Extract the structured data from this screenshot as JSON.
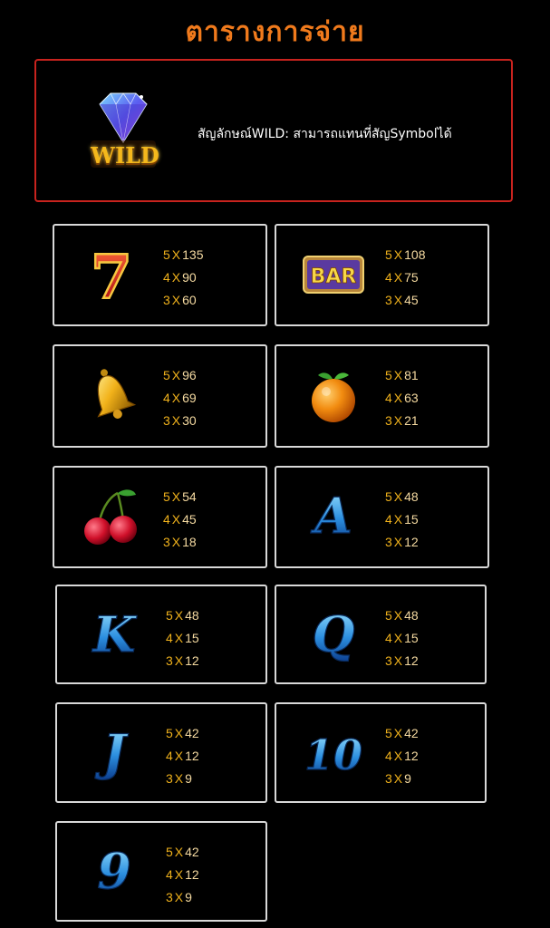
{
  "title": "ตารางการจ่าย",
  "wild": {
    "icon": "diamond-wild-icon",
    "description": "สัญลักษณ์WILD: สามารถแทนที่สัญSymbolได้"
  },
  "colors": {
    "title": "#f07a1c",
    "wild_border": "#c8231e",
    "card_border": "#d9d9d9",
    "multiplier": "#f0b21c"
  },
  "symbols": [
    {
      "icon": "seven-icon",
      "pays": [
        {
          "count": "5",
          "mult": "135"
        },
        {
          "count": "4",
          "mult": "90"
        },
        {
          "count": "3",
          "mult": "60"
        }
      ]
    },
    {
      "icon": "bar-icon",
      "label": "BAR",
      "pays": [
        {
          "count": "5",
          "mult": "108"
        },
        {
          "count": "4",
          "mult": "75"
        },
        {
          "count": "3",
          "mult": "45"
        }
      ]
    },
    {
      "icon": "bell-icon",
      "pays": [
        {
          "count": "5",
          "mult": "96"
        },
        {
          "count": "4",
          "mult": "69"
        },
        {
          "count": "3",
          "mult": "30"
        }
      ]
    },
    {
      "icon": "orange-icon",
      "pays": [
        {
          "count": "5",
          "mult": "81"
        },
        {
          "count": "4",
          "mult": "63"
        },
        {
          "count": "3",
          "mult": "21"
        }
      ]
    },
    {
      "icon": "cherry-icon",
      "pays": [
        {
          "count": "5",
          "mult": "54"
        },
        {
          "count": "4",
          "mult": "45"
        },
        {
          "count": "3",
          "mult": "18"
        }
      ]
    },
    {
      "icon": "letter-a-icon",
      "label": "A",
      "pays": [
        {
          "count": "5",
          "mult": "48"
        },
        {
          "count": "4",
          "mult": "15"
        },
        {
          "count": "3",
          "mult": "12"
        }
      ]
    },
    {
      "icon": "letter-k-icon",
      "label": "K",
      "pays": [
        {
          "count": "5",
          "mult": "48"
        },
        {
          "count": "4",
          "mult": "15"
        },
        {
          "count": "3",
          "mult": "12"
        }
      ]
    },
    {
      "icon": "letter-q-icon",
      "label": "Q",
      "pays": [
        {
          "count": "5",
          "mult": "48"
        },
        {
          "count": "4",
          "mult": "15"
        },
        {
          "count": "3",
          "mult": "12"
        }
      ]
    },
    {
      "icon": "letter-j-icon",
      "label": "J",
      "pays": [
        {
          "count": "5",
          "mult": "42"
        },
        {
          "count": "4",
          "mult": "12"
        },
        {
          "count": "3",
          "mult": "9"
        }
      ]
    },
    {
      "icon": "number-10-icon",
      "label": "10",
      "pays": [
        {
          "count": "5",
          "mult": "42"
        },
        {
          "count": "4",
          "mult": "12"
        },
        {
          "count": "3",
          "mult": "9"
        }
      ]
    },
    {
      "icon": "number-9-icon",
      "label": "9",
      "pays": [
        {
          "count": "5",
          "mult": "42"
        },
        {
          "count": "4",
          "mult": "12"
        },
        {
          "count": "3",
          "mult": "9"
        }
      ]
    }
  ],
  "x_sign": "X"
}
